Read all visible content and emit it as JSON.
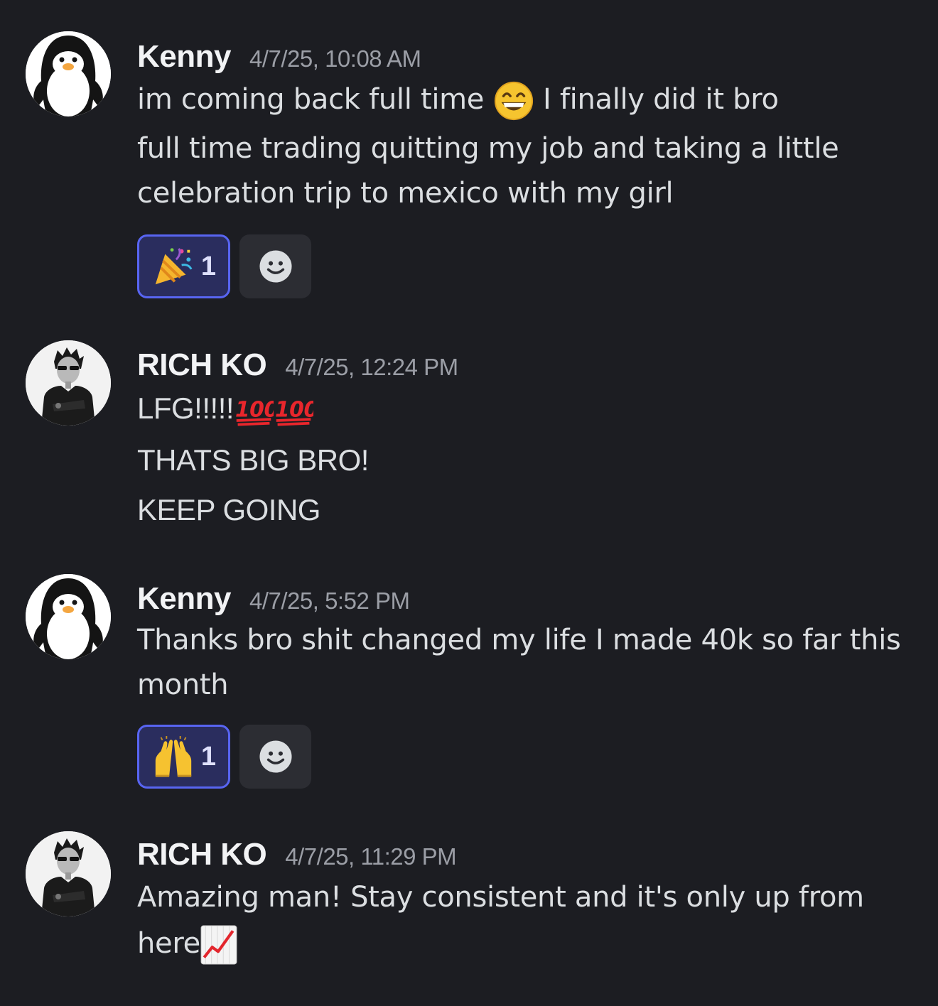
{
  "messages": [
    {
      "author": "Kenny",
      "timestamp": "4/7/25, 10:08 AM",
      "avatar_icon": "penguin-avatar",
      "lines": [
        {
          "before": "im coming back full time ",
          "emoji": "grinning-face-emoji",
          "after": " I finally did it bro"
        },
        {
          "text": "full time trading quitting my job and taking a little"
        },
        {
          "text": "celebration trip to mexico with my girl"
        }
      ],
      "reaction": {
        "emoji": "party-popper-emoji",
        "count": "1"
      }
    },
    {
      "author": "RICH KO",
      "timestamp": "4/7/25, 12:24 PM",
      "avatar_icon": "rich-ko-avatar",
      "lines": [
        {
          "text": "LFG!!!!!",
          "emoji": "hundred-points-emoji"
        },
        {
          "text": "THATS BIG BRO!"
        },
        {
          "text": "KEEP GOING"
        }
      ]
    },
    {
      "author": "Kenny",
      "timestamp": "4/7/25, 5:52 PM",
      "avatar_icon": "penguin-avatar",
      "lines": [
        {
          "text": "Thanks bro shit changed my life I made 40k so far this"
        },
        {
          "text": "month"
        }
      ],
      "reaction": {
        "emoji": "raising-hands-emoji",
        "count": "1"
      }
    },
    {
      "author": "RICH KO",
      "timestamp": "4/7/25, 11:29 PM",
      "avatar_icon": "rich-ko-avatar",
      "lines": [
        {
          "text": "Amazing man! Stay consistent and it's only up from"
        },
        {
          "text": "here",
          "emoji": "chart-increasing-emoji"
        }
      ]
    }
  ],
  "colors": {
    "background": "#1c1d22",
    "reaction_active_bg": "#2a2d5e",
    "reaction_active_border": "#5865f2",
    "add_reaction_bg": "#2c2d33"
  }
}
